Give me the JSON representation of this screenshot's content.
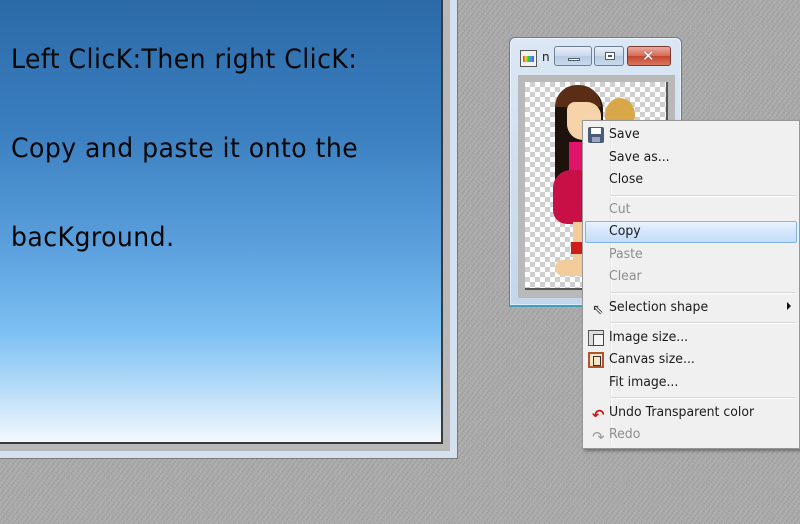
{
  "canvas_window": {
    "instruction_lines": [
      "Left ClicK:Then right ClicK:",
      "Copy and paste it onto the",
      "bacKground."
    ]
  },
  "image_window": {
    "title": "n",
    "buttons": {
      "minimize": "minimize",
      "maximize": "maximize",
      "close": "✕"
    }
  },
  "context_menu": {
    "items": [
      {
        "label": "Save",
        "icon": "save-icon",
        "enabled": true
      },
      {
        "label": "Save as...",
        "enabled": true
      },
      {
        "label": "Close",
        "enabled": true
      },
      {
        "label": "Cut",
        "enabled": false
      },
      {
        "label": "Copy",
        "enabled": true,
        "highlighted": true
      },
      {
        "label": "Paste",
        "enabled": false
      },
      {
        "label": "Clear",
        "enabled": false
      },
      {
        "label": "Selection shape",
        "icon": "pointer-icon",
        "enabled": true,
        "submenu": true
      },
      {
        "label": "Image size...",
        "icon": "image-size-icon",
        "enabled": true
      },
      {
        "label": "Canvas size...",
        "icon": "canvas-size-icon",
        "enabled": true
      },
      {
        "label": "Fit image...",
        "enabled": true
      },
      {
        "label": "Undo Transparent color",
        "icon": "undo-icon",
        "enabled": true
      },
      {
        "label": "Redo",
        "icon": "redo-icon",
        "enabled": false
      }
    ],
    "glyphs": {
      "undo": "↶",
      "redo": "↷",
      "pointer": "⇖"
    }
  },
  "colors": {
    "highlight_border": "#7eb4ea",
    "disabled_text": "#8d8d8d",
    "undo_red": "#d11212"
  }
}
